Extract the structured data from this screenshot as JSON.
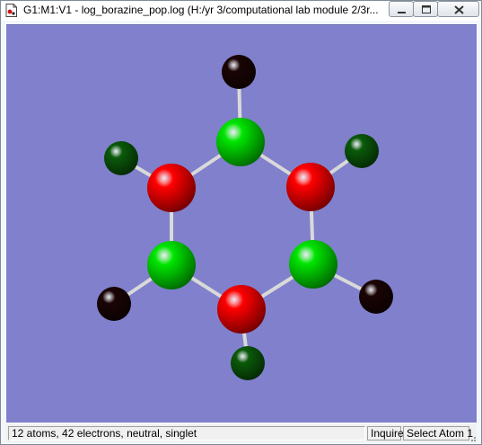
{
  "window": {
    "title": "G1:M1:V1 - log_borazine_pop.log (H:/yr 3/computational lab module 2/3r..."
  },
  "icons": {
    "app": "log-file-icon",
    "minimize": "minimize-icon",
    "maximize": "maximize-icon",
    "close": "close-icon"
  },
  "viewer": {
    "background_color": "#8080cc",
    "bond_color": "#d9d9d9",
    "element_colors": {
      "B": "#ff0000",
      "N": "#00e600",
      "H_on_N": "#0a5a0a",
      "H_on_B": "#1a0404"
    },
    "atoms": [
      {
        "element": "N"
      },
      {
        "element": "B"
      },
      {
        "element": "N"
      },
      {
        "element": "B"
      },
      {
        "element": "N"
      },
      {
        "element": "B"
      },
      {
        "element": "H"
      },
      {
        "element": "H"
      },
      {
        "element": "H"
      },
      {
        "element": "H"
      },
      {
        "element": "H"
      },
      {
        "element": "H"
      }
    ]
  },
  "status": {
    "info": "12 atoms, 42 electrons, neutral, singlet",
    "mode": "Inquire",
    "hint": "Select Atom 1"
  }
}
